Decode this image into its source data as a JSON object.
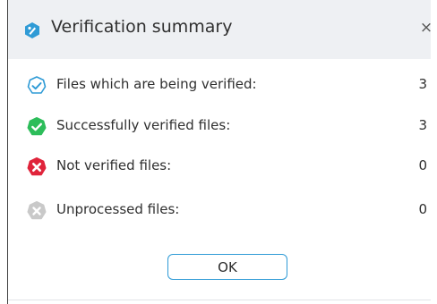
{
  "dialog": {
    "title": "Verification summary",
    "close_glyph": "×",
    "title_icon": "app-logo-icon",
    "ok_label": "OK"
  },
  "rows": [
    {
      "label": "Files which are being verified:",
      "count": "3",
      "icon": "verifying-icon",
      "color": "#2f9bd6"
    },
    {
      "label": "Successfully verified files:",
      "count": "3",
      "icon": "success-check-icon",
      "color": "#2dbd5a"
    },
    {
      "label": "Not verified files:",
      "count": "0",
      "icon": "error-x-icon",
      "color": "#e0243b"
    },
    {
      "label": "Unprocessed files:",
      "count": "0",
      "icon": "unprocessed-x-icon",
      "color": "#c9c9c9"
    }
  ]
}
